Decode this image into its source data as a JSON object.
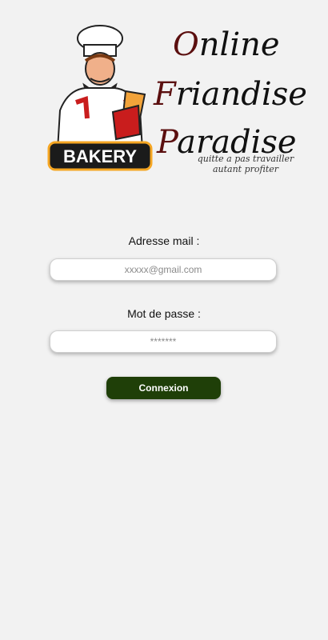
{
  "brand": {
    "line1_first": "O",
    "line1_rest": "nline",
    "line2_first": "F",
    "line2_rest": "riandise",
    "line3_first": "P",
    "line3_rest": "aradise",
    "tagline_line1": "quitte a pas travailler",
    "tagline_line2": "autant profiter",
    "logo_text": "BAKERY",
    "logo_icon": "chef-baker-icon",
    "accent_color": "#5b0f0f"
  },
  "form": {
    "email_label": "Adresse mail :",
    "email_placeholder": "xxxxx@gmail.com",
    "password_label": "Mot de passe :",
    "password_placeholder": "*******",
    "submit_label": "Connexion",
    "submit_color": "#1f3f08"
  }
}
